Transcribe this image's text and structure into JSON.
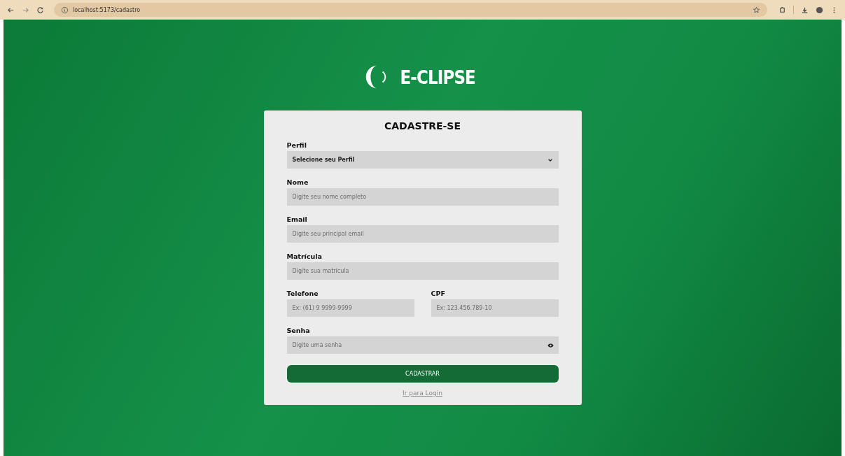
{
  "browser": {
    "url": "localhost:5173/cadastro"
  },
  "logo": {
    "text": "E-CLIPSE"
  },
  "form": {
    "title": "CADASTRE-SE",
    "rows": [
      {
        "fields": [
          {
            "kind": "select",
            "label": "Perfil",
            "value": "Selecione seu Perfil"
          }
        ]
      },
      {
        "fields": [
          {
            "kind": "text",
            "label": "Nome",
            "placeholder": "Digite seu nome completo"
          }
        ]
      },
      {
        "fields": [
          {
            "kind": "text",
            "label": "Email",
            "placeholder": "Digite seu principal email"
          }
        ]
      },
      {
        "fields": [
          {
            "kind": "text",
            "label": "Matrícula",
            "placeholder": "Digite sua matrícula"
          }
        ]
      },
      {
        "fields": [
          {
            "kind": "text",
            "label": "Telefone",
            "placeholder": "Ex: (61) 9 9999-9999"
          },
          {
            "kind": "text",
            "label": "CPF",
            "placeholder": "Ex: 123.456.789-10"
          }
        ]
      },
      {
        "fields": [
          {
            "kind": "password",
            "label": "Senha",
            "placeholder": "Digite uma senha"
          }
        ]
      }
    ],
    "submit": "CADASTRAR",
    "link": "Ir para Login"
  }
}
